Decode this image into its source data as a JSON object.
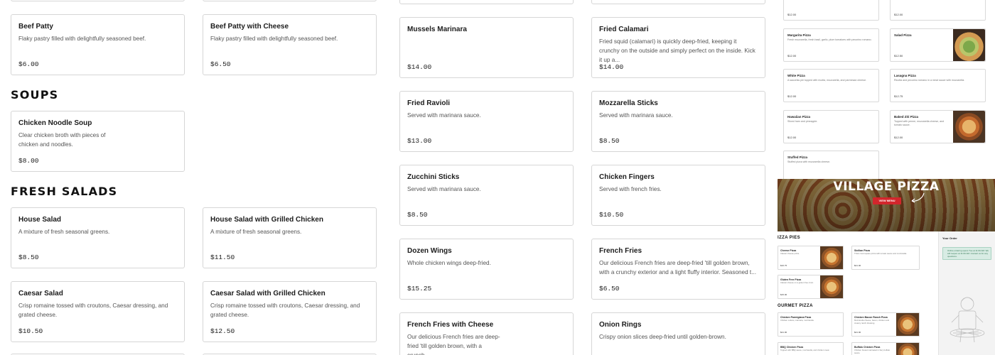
{
  "left": {
    "top_cards": [
      {
        "name": "Beef Patty",
        "desc": "Flaky pastry filled with delightfully seasoned beef.",
        "price": "$6.00"
      },
      {
        "name": "Beef Patty with Cheese",
        "desc": "Flaky pastry filled with delightfully seasoned beef.",
        "price": "$6.50"
      }
    ],
    "soups_title": "SOUPS",
    "soups": [
      {
        "name": "Chicken Noodle Soup",
        "desc": "Clear chicken broth with pieces of chicken and noodles.",
        "price": "$8.00"
      }
    ],
    "salads_title": "FRESH SALADS",
    "salads": [
      {
        "name": "House Salad",
        "desc": "A mixture of fresh seasonal greens.",
        "price": "$8.50"
      },
      {
        "name": "House Salad with Grilled Chicken",
        "desc": "A mixture of fresh seasonal greens.",
        "price": "$11.50"
      },
      {
        "name": "Caesar Salad",
        "desc": "Crisp romaine tossed with croutons, Caesar dressing, and grated cheese.",
        "price": "$10.50"
      },
      {
        "name": "Caesar Salad with Grilled Chicken",
        "desc": "Crisp romaine tossed with croutons, Caesar dressing, and grated cheese.",
        "price": "$12.50"
      }
    ]
  },
  "middle": {
    "cards": [
      {
        "name": "Mussels Marinara",
        "desc": "",
        "price": "$14.00"
      },
      {
        "name": "Fried Calamari",
        "desc": "Fried squid (calamari) is quickly deep-fried, keeping it crunchy on the outside and simply perfect on the inside. Kick it up a...",
        "price": "$14.00"
      },
      {
        "name": "Fried Ravioli",
        "desc": "Served with marinara sauce.",
        "price": "$13.00"
      },
      {
        "name": "Mozzarella Sticks",
        "desc": "Served with marinara sauce.",
        "price": "$8.50"
      },
      {
        "name": "Zucchini Sticks",
        "desc": "Served with marinara sauce.",
        "price": "$8.50"
      },
      {
        "name": "Chicken Fingers",
        "desc": "Served with french fries.",
        "price": "$10.50"
      },
      {
        "name": "Dozen Wings",
        "desc": "Whole chicken wings deep-fried.",
        "price": "$15.25"
      },
      {
        "name": "French Fries",
        "desc": "Our delicious French fries are deep-fried 'till golden brown, with a crunchy exterior and a light fluffy interior. Seasoned t...",
        "price": "$6.50"
      },
      {
        "name": "French Fries with Cheese",
        "desc": "Our delicious French fries are deep-fried 'till golden brown, with a crunch...",
        "price": ""
      },
      {
        "name": "Onion Rings",
        "desc": "Crispy onion slices deep-fried until golden-brown.",
        "price": ""
      }
    ]
  },
  "thumb_top": {
    "items": [
      {
        "name": "",
        "desc": "",
        "price": "$12.00",
        "img": false
      },
      {
        "name": "",
        "desc": "",
        "price": "$12.00",
        "img": false
      },
      {
        "name": "Margarita Pizza",
        "desc": "Fresh mozzarella, fresh basil, garlic, plum tomatoes with pecorino romano.",
        "price": "$12.00",
        "img": false
      },
      {
        "name": "Salad Pizza",
        "desc": "",
        "price": "$12.50",
        "img": true
      },
      {
        "name": "White Pizza",
        "desc": "A saucelss pie topped with ricotta, mozzarella, and parmesan cheese.",
        "price": "$12.00",
        "img": false
      },
      {
        "name": "Lasagna Pizza",
        "desc": "Ricotta and pecorino romano in a meat sauce with mozzarella.",
        "price": "$12.75",
        "img": false
      },
      {
        "name": "Hawaiian Pizza",
        "desc": "Sliced ham and pineapple.",
        "price": "$12.00",
        "img": false
      },
      {
        "name": "Baked Ziti Pizza",
        "desc": "Topped with penne, mozzarella cheese, and tomato sauce.",
        "price": "$12.00",
        "img": true
      },
      {
        "name": "Stuffed Pizza",
        "desc": "Stuffed pizza with mozzarella cheese.",
        "price": "",
        "img": false
      }
    ]
  },
  "thumb_bottom": {
    "hero_title": "VILLAGE PIZZA",
    "hero_button": "VIEW MENU",
    "section1": "IZZA PIES",
    "section2": "OURMET PIZZA",
    "order_title": "Your Order",
    "order_notice": "Online ordering opens Tue at 11:00 AM. We will reopen at 11:00 AM. Contact us for any questions.",
    "items": [
      {
        "name": "Cheese Pizza",
        "desc": "Classic cheese pizza.",
        "price": "$16.75",
        "img": true
      },
      {
        "name": "Sicilian Pizza",
        "desc": "Thick crust square pizza with tomato sauce and mozzarella.",
        "price": "$21.00",
        "img": false
      },
      {
        "name": "Gluten Free Pizza",
        "desc": "Classic cheese on a gluten free crust.",
        "price": "$15.00",
        "img": true
      },
      {
        "name": "Chicken Parmigiana Pizza",
        "desc": "Chicken cutlets, marinara, mozzarella.",
        "price": "$21.00",
        "img": false
      },
      {
        "name": "Chicken Bacon Ranch Pizza",
        "desc": "Mozzarella cheese, bacon, chicken and creamy ranch dressing.",
        "price": "$21.00",
        "img": true
      },
      {
        "name": "BBQ Chicken Pizza",
        "desc": "Topped with BBQ sauce, mozzarella, and chicken meat.",
        "price": "",
        "img": false
      },
      {
        "name": "Buffalo Chicken Pizza",
        "desc": "Chicken breast marinated in fiery buffalo sauce.",
        "price": "",
        "img": true
      }
    ]
  }
}
